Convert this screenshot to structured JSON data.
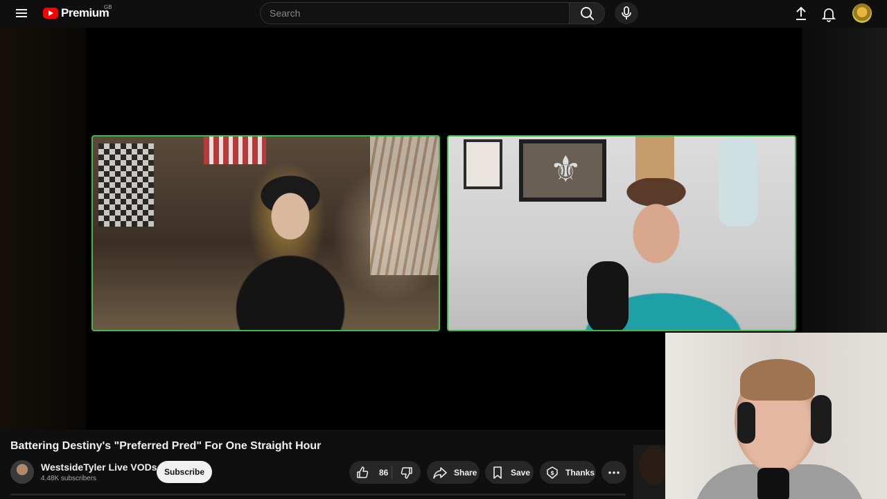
{
  "header": {
    "logo_text": "Premium",
    "region_code": "GB",
    "search": {
      "placeholder": "Search",
      "value": ""
    }
  },
  "video": {
    "title": "Battering Destiny's \"Preferred Pred\" For One Straight Hour",
    "channel": {
      "name": "WestsideTyler Live VODs",
      "subscribers": "4.48K subscribers",
      "subscribe_label": "Subscribe"
    },
    "actions": {
      "like_count": "86",
      "share_label": "Share",
      "save_label": "Save",
      "thanks_label": "Thanks"
    }
  },
  "colors": {
    "background": "#0f0f0f",
    "brand_red": "#ff0000",
    "cam_border": "#43b64a",
    "pill_bg": "#272727",
    "subscribe_bg": "#f1f1f1"
  },
  "icons": [
    "menu-icon",
    "youtube-logo-icon",
    "search-icon",
    "mic-icon",
    "upload-icon",
    "bell-icon",
    "thumbs-up-icon",
    "thumbs-down-icon",
    "share-icon",
    "bookmark-icon",
    "thanks-icon",
    "more-icon"
  ]
}
